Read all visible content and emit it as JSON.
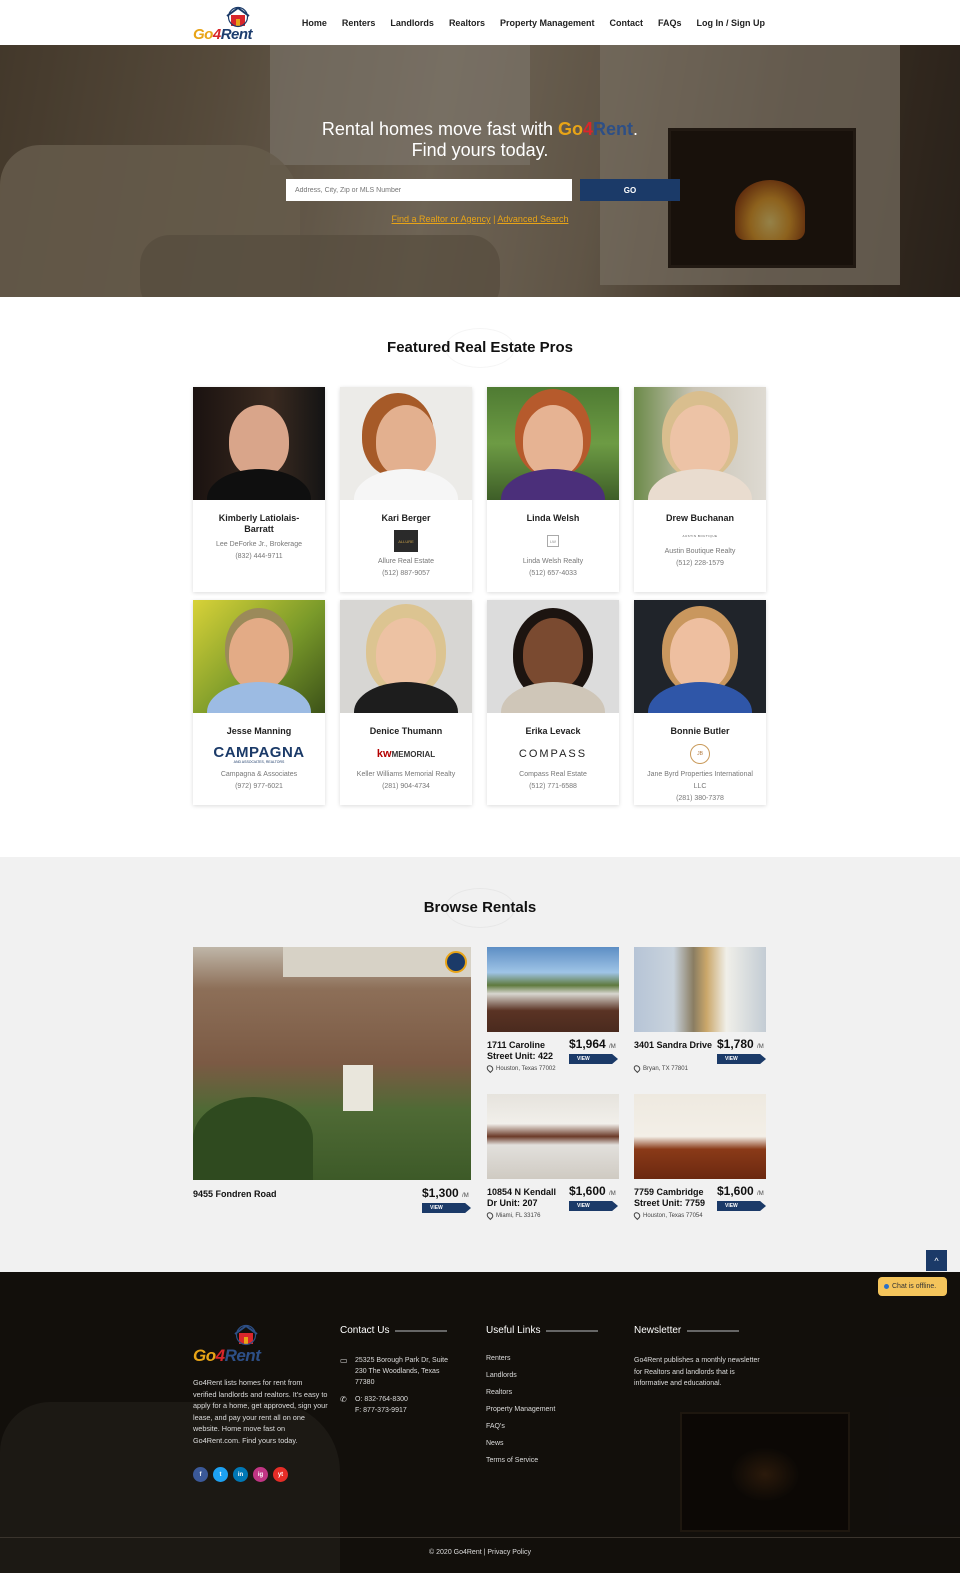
{
  "header": {
    "brand": {
      "go": "Go",
      "four": "4",
      "rent": "Rent"
    },
    "nav": [
      "Home",
      "Renters",
      "Landlords",
      "Realtors",
      "Property Management",
      "Contact",
      "FAQs",
      "Log In / Sign Up"
    ]
  },
  "hero": {
    "headline_before": "Rental homes move fast with ",
    "brand": {
      "go": "Go",
      "four": "4",
      "rent": "Rent"
    },
    "headline_after": ".",
    "headline_line2": "Find yours today.",
    "search_placeholder": "Address, City, Zip or MLS Number",
    "go_label": "GO",
    "link_realtor": "Find a Realtor or Agency",
    "link_separator": " | ",
    "link_advanced": "Advanced Search"
  },
  "featured": {
    "title": "Featured Real Estate Pros",
    "agents": [
      {
        "name": "Kimberly Latiolais-Barratt",
        "company": "Lee DeForke Jr., Brokerage",
        "phone": "(832) 444-9711",
        "logo": ""
      },
      {
        "name": "Kari Berger",
        "company": "Allure Real Estate",
        "phone": "(512) 887-9057",
        "logo": "ALLURE"
      },
      {
        "name": "Linda Welsh",
        "company": "Linda Welsh Realty",
        "phone": "(512) 657-4033",
        "logo": "LW"
      },
      {
        "name": "Drew Buchanan",
        "company": "Austin Boutique Realty",
        "phone": "(512) 228-1579",
        "logo": "AUSTIN BOUTIQUE"
      },
      {
        "name": "Jesse Manning",
        "company": "Campagna & Associates",
        "phone": "(972) 977-6021",
        "logo": "CAMPAGNA",
        "logo_sub": "AND ASSOCIATES, REALTORS"
      },
      {
        "name": "Denice Thumann",
        "company": "Keller Williams Memorial Realty",
        "phone": "(281) 904-4734",
        "logo": "MEMORIAL",
        "logo_kw": "kw"
      },
      {
        "name": "Erika Levack",
        "company": "Compass Real Estate",
        "phone": "(512) 771-6588",
        "logo": "COMPASS"
      },
      {
        "name": "Bonnie Butler",
        "company": "Jane Byrd Properties International LLC",
        "phone": "(281) 380-7378",
        "logo": "JB"
      }
    ]
  },
  "rentals": {
    "title": "Browse Rentals",
    "per_label": "/M",
    "view_label": "VIEW",
    "items": [
      {
        "title": "9455 Fondren Road",
        "price": "$1,300",
        "location": ""
      },
      {
        "title": "1711 Caroline Street Unit: 422",
        "price": "$1,964",
        "location": "Houston, Texas 77002"
      },
      {
        "title": "3401 Sandra Drive",
        "price": "$1,780",
        "location": "Bryan, TX 77801"
      },
      {
        "title": "10854 N Kendall Dr Unit: 207",
        "price": "$1,600",
        "location": "Miami, FL 33176"
      },
      {
        "title": "7759 Cambridge Street Unit: 7759",
        "price": "$1,600",
        "location": "Houston, Texas 77054"
      }
    ]
  },
  "widgets": {
    "back_to_top": "^",
    "chat": "Chat is offline."
  },
  "footer": {
    "brand": {
      "go": "Go",
      "four": "4",
      "rent": "Rent"
    },
    "about": "Go4Rent lists homes for rent from verified landlords and realtors. It's easy to apply for a home, get approved, sign your lease, and pay your rent all on one website. Home move fast on Go4Rent.com. Find yours today.",
    "socials": [
      "f",
      "t",
      "in",
      "ig",
      "yt"
    ],
    "contact_title": "Contact Us",
    "address": "25325 Borough Park Dr, Suite 230 The Woodlands, Texas 77380",
    "phone": "O: 832-764-8300",
    "fax": "F: 877-373-9917",
    "links_title": "Useful Links",
    "links": [
      "Renters",
      "Landlords",
      "Realtors",
      "Property Management",
      "FAQ's",
      "News",
      "Terms of Service"
    ],
    "newsletter_title": "Newsletter",
    "newsletter_text": "Go4Rent publishes a monthly newsletter for Realtors and landlords that is informative and educational.",
    "copyright": "© 2020 Go4Rent | Privacy Policy"
  },
  "colors": {
    "brand_navy": "#1b3a68",
    "brand_gold": "#e8a417",
    "brand_red": "#d8262b"
  }
}
